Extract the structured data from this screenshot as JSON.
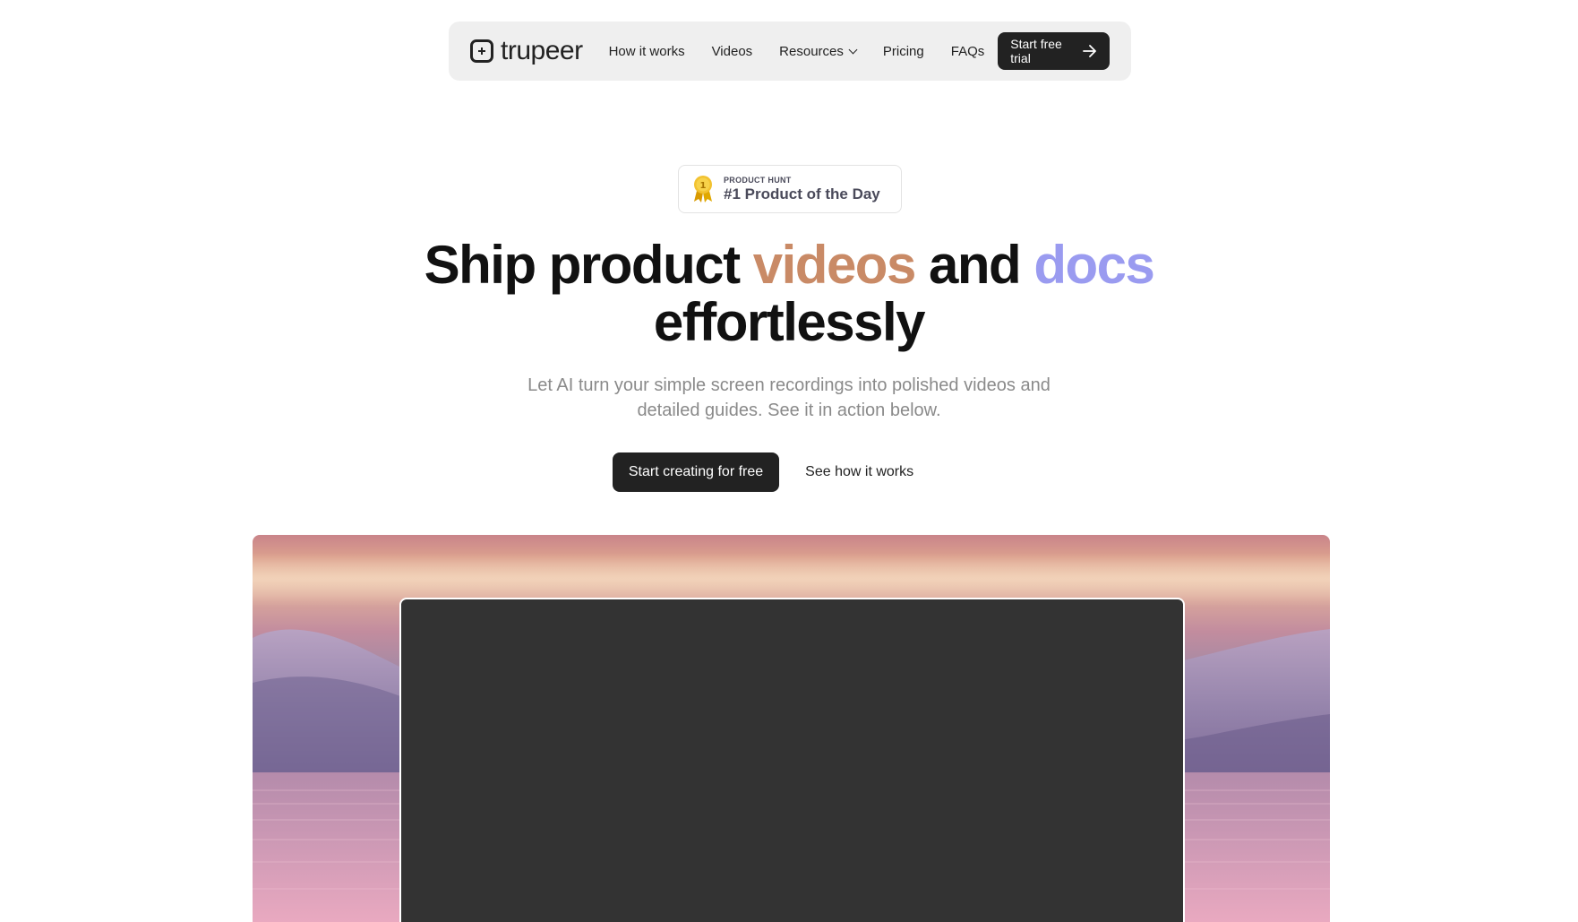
{
  "brand": {
    "name": "trupeer"
  },
  "nav": {
    "links": [
      "How it works",
      "Videos",
      "Resources",
      "Pricing",
      "FAQs"
    ],
    "cta": "Start free trial"
  },
  "badge": {
    "source": "PRODUCT HUNT",
    "title": "#1 Product of the Day"
  },
  "headline": {
    "part1": "Ship product ",
    "highlight1": "videos",
    "part2": " and ",
    "highlight2": "docs",
    "part3": "effortlessly"
  },
  "subheadline": "Let AI turn your simple screen recordings into polished videos and detailed guides. See it in action below.",
  "actions": {
    "primary": "Start creating for free",
    "secondary": "See how it works"
  },
  "colors": {
    "dark": "#222222",
    "videos_highlight": "#c98a66",
    "docs_highlight": "#9a9bf0",
    "muted_text": "#8a8a8a",
    "video_placeholder": "#333333"
  }
}
